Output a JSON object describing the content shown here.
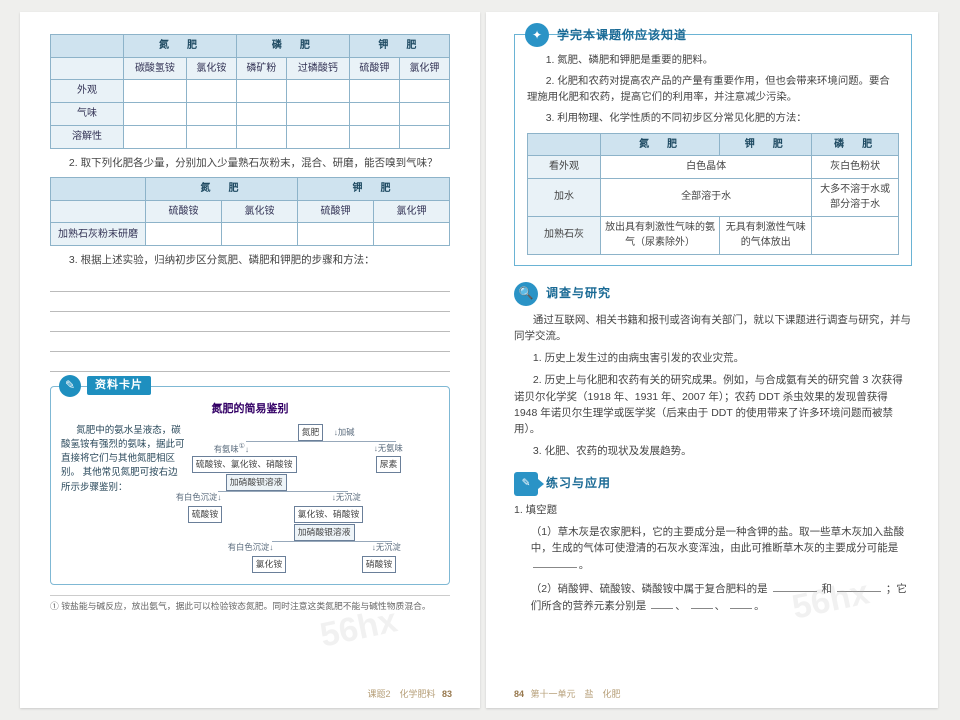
{
  "left": {
    "table1": {
      "groupHeaders": [
        "氮　肥",
        "磷　肥",
        "钾　肥"
      ],
      "subHeaders": [
        "碳酸氢铵",
        "氯化铵",
        "磷矿粉",
        "过磷酸钙",
        "硫酸钾",
        "氯化钾"
      ],
      "rowLabels": [
        "外观",
        "气味",
        "溶解性"
      ]
    },
    "step2": "2. 取下列化肥各少量，分别加入少量熟石灰粉末，混合、研磨，能否嗅到气味？",
    "table2": {
      "groupHeaders": [
        "氮　肥",
        "钾　肥"
      ],
      "subHeaders": [
        "硫酸铵",
        "氯化铵",
        "硫酸钾",
        "氯化钾"
      ],
      "rowLabel": "加熟石灰粉末研磨"
    },
    "step3": "3. 根据上述实验，归纳初步区分氮肥、磷肥和钾肥的步骤和方法：",
    "card": {
      "tag": "资料卡片",
      "title": "氮肥的简易鉴别",
      "leftText": "氮肥中的氨水呈液态，碳酸氢铵有强烈的氨味，据此可直接将它们与其他氮肥相区别。\n其他常见氮肥可按右边所示步骤鉴别：",
      "boxes": {
        "n": "氮肥",
        "arrow": "加碱",
        "hasSmell": "有氨味",
        "noSmell": "无氨味",
        "row1": "硫酸铵、氯化铵、硝酸铵",
        "urea": "尿素",
        "barium": "加硝酸钡溶液",
        "whiteppt": "有白色沉淀",
        "noppt": "无沉淀",
        "s1": "硫酸铵",
        "s2": "氯化铵、硝酸铵",
        "silver": "加硝酸银溶液",
        "whiteppt2": "有白色沉淀",
        "noppt2": "无沉淀",
        "c1": "氯化铵",
        "c2": "硝酸铵",
        "noteup": "①"
      }
    },
    "footnote": "① 铵盐能与碱反应，放出氨气，据此可以检验铵态氮肥。同时注意这类氮肥不能与碱性物质混合。",
    "footer": {
      "text": "课题2　化学肥料",
      "page": "83"
    }
  },
  "right": {
    "box1": {
      "title": "学完本课题你应该知道",
      "p1": "1. 氮肥、磷肥和钾肥是重要的肥料。",
      "p2": "2. 化肥和农药对提高农产品的产量有重要作用，但也会带来环境问题。要合理施用化肥和农药，提高它们的利用率，并注意减少污染。",
      "p3": "3. 利用物理、化学性质的不同初步区分常见化肥的方法：",
      "table": {
        "header": [
          "氮　肥",
          "钾　肥",
          "磷　肥"
        ],
        "rows": {
          "look": {
            "label": "看外观",
            "nk": "白色晶体",
            "p": "灰白色粉状"
          },
          "water": {
            "label": "加水",
            "nk": "全部溶于水",
            "p": "大多不溶于水或部分溶于水"
          },
          "lime": {
            "label": "加熟石灰",
            "n": "放出具有刺激性气味的氨气（尿素除外）",
            "k": "无具有刺激性气味的气体放出",
            "p": ""
          }
        }
      }
    },
    "section2": {
      "title": "调查与研究",
      "intro": "通过互联网、相关书籍和报刊或咨询有关部门，就以下课题进行调查与研究，并与同学交流。",
      "i1": "1. 历史上发生过的由病虫害引发的农业灾荒。",
      "i2": "2. 历史上与化肥和农药有关的研究成果。例如，与合成氨有关的研究曾 3 次获得诺贝尔化学奖（1918 年、1931 年、2007 年）；农药 DDT 杀虫效果的发现曾获得 1948 年诺贝尔生理学或医学奖（后来由于 DDT 的使用带来了许多环境问题而被禁用）。",
      "i3": "3. 化肥、农药的现状及发展趋势。"
    },
    "section3": {
      "title": "练习与应用",
      "head": "1. 填空题",
      "q1a": "（1）草木灰是农家肥料，它的主要成分是一种含钾的盐。取一些草木灰加入盐酸中，生成的气体可使澄清的石灰水变浑浊，由此可推断草木灰的主要成分可能是",
      "q1b": "（2）硝酸钾、硫酸铵、磷酸铵中属于复合肥料的是",
      "q1c": "；它们所含的营养元素分别是",
      "and": "和"
    },
    "footer": {
      "page": "84",
      "text": "第十一单元　盐　化肥"
    }
  },
  "watermark": "56hx"
}
